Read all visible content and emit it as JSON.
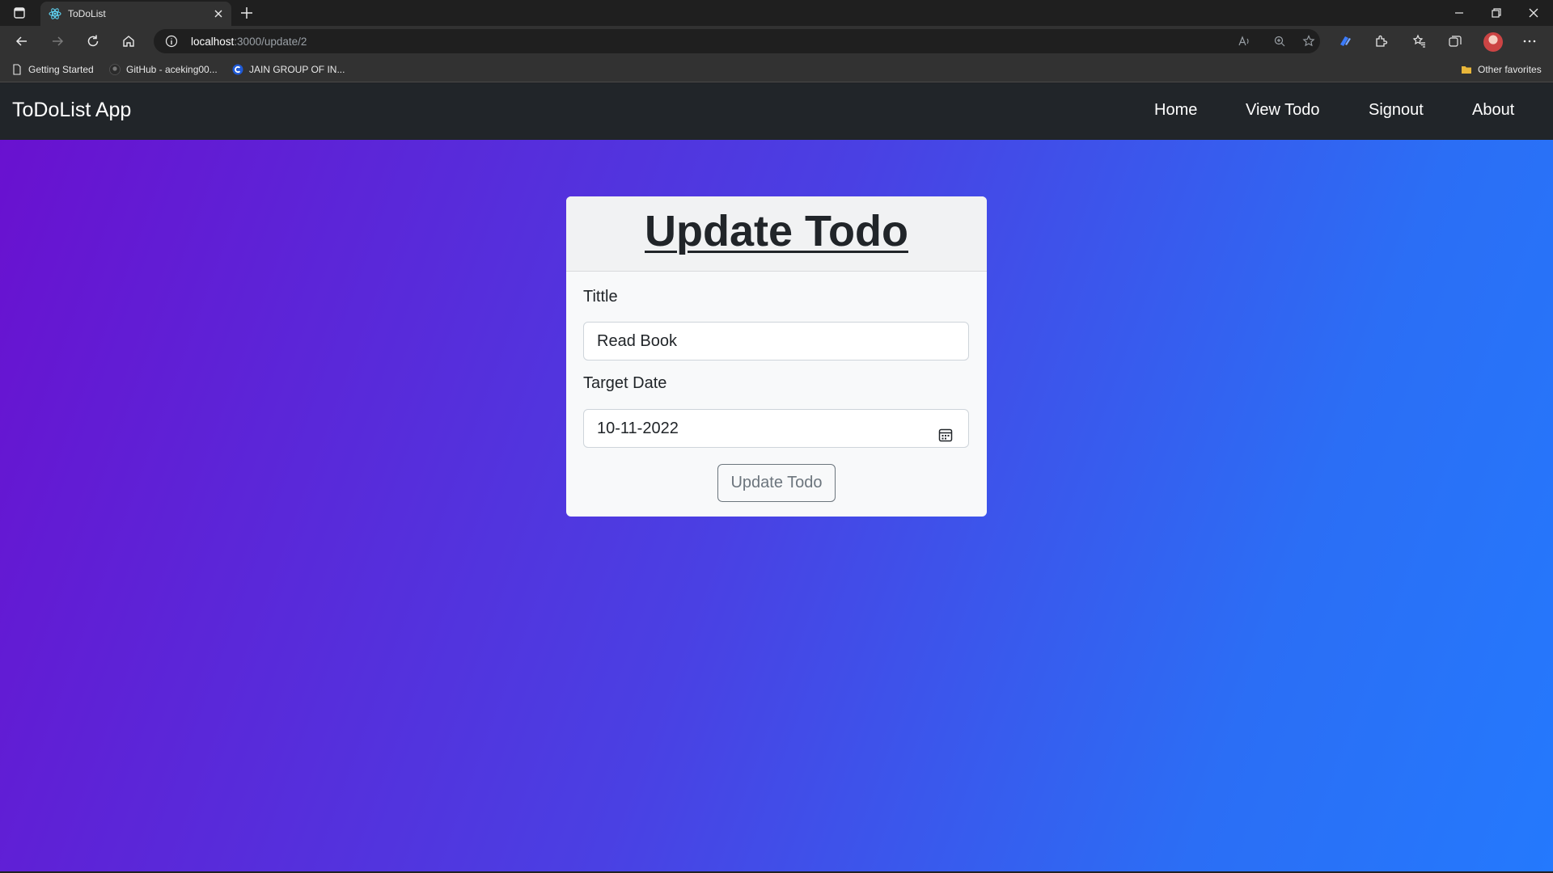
{
  "browser": {
    "tab_title": "ToDoList",
    "url_host": "localhost",
    "url_path": ":3000/update/2",
    "bookmarks": [
      "Getting Started",
      "GitHub - aceking00...",
      "JAIN GROUP OF IN..."
    ],
    "other_favorites": "Other favorites"
  },
  "navbar": {
    "brand": "ToDoList App",
    "links": [
      "Home",
      "View Todo",
      "Signout",
      "About"
    ]
  },
  "form": {
    "heading": "Update Todo",
    "title_label": "Tittle",
    "title_value": "Read Book",
    "date_label": "Target Date",
    "date_value": "10-11-2022",
    "submit_label": "Update Todo"
  },
  "colors": {
    "navbar": "#212529",
    "gradient_start": "#6a10cf",
    "gradient_end": "#2479fd",
    "card": "#f8f9fa"
  }
}
